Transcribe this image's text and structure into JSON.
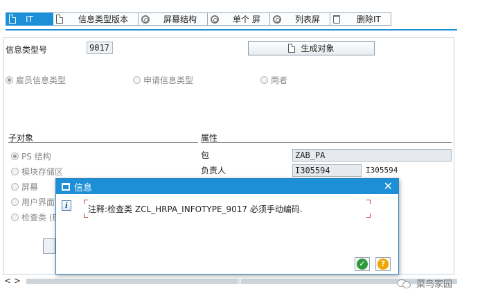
{
  "toolbar": {
    "tabs": [
      {
        "label": "IT",
        "icon": "document-icon",
        "active": true
      },
      {
        "label": "信息类型版本",
        "icon": "document-icon"
      },
      {
        "label": "屏幕结构",
        "icon": "circle-icon"
      },
      {
        "label": "单个 屏",
        "icon": "circle-icon"
      },
      {
        "label": "列表屏",
        "icon": "circle-icon"
      },
      {
        "label": "删除IT",
        "icon": "trash-icon"
      }
    ],
    "accent": "#1d8fd6"
  },
  "form": {
    "infotype_label": "信息类型号",
    "infotype_value": "9017",
    "generate_button": "生成对象"
  },
  "type_radios": [
    {
      "label": "雇员信息类型",
      "selected": true
    },
    {
      "label": "申请信息类型",
      "selected": false
    },
    {
      "label": "两者",
      "selected": false
    }
  ],
  "subobjects": {
    "title": "子对象",
    "items": [
      {
        "label": "PS 结构",
        "selected": true
      },
      {
        "label": "模块存储区",
        "selected": false
      },
      {
        "label": "屏幕",
        "selected": false
      },
      {
        "label": "用户界面",
        "selected": false
      },
      {
        "label": "检查类 (E",
        "selected": false
      }
    ]
  },
  "attributes": {
    "title": "属性",
    "rows": [
      {
        "label": "包",
        "value": "ZAB_PA",
        "extra": ""
      },
      {
        "label": "负责人",
        "value": "I305594",
        "extra": "I305594"
      }
    ]
  },
  "dialog": {
    "title": "信息",
    "message": "注释:检查类 ZCL_HRPA_INFOTYPE_9017 必须手动编码.",
    "ok_icon": "check-icon",
    "help_icon": "help-icon"
  },
  "scrollbar": {
    "left": "<",
    "right": ">",
    "grip": "|||"
  },
  "watermark": "菜鸟家园"
}
